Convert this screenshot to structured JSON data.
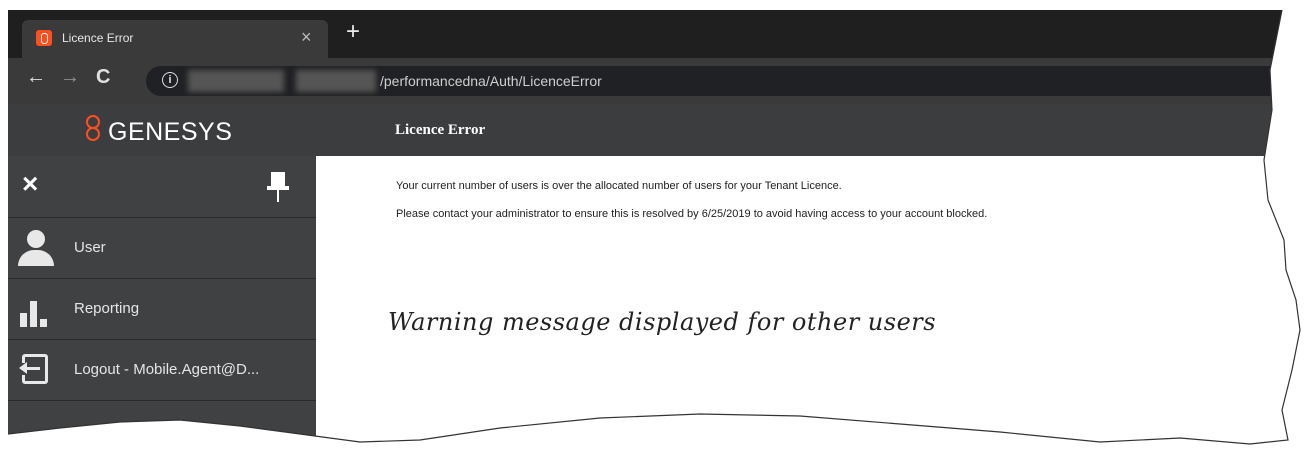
{
  "browser": {
    "tab": {
      "title": "Licence Error",
      "close": "×",
      "favicon": "genesys-favicon-icon"
    },
    "new_tab": "+",
    "nav": {
      "back": "←",
      "forward": "→",
      "reload": "C",
      "info": "i"
    },
    "url": "/performancedna/Auth/LicenceError"
  },
  "app": {
    "logo_text": "GENESYS",
    "page_title": "Licence Error"
  },
  "sidebar": {
    "close_icon": "×",
    "items": [
      {
        "label": "User",
        "icon": "user-icon"
      },
      {
        "label": "Reporting",
        "icon": "bar-chart-icon"
      },
      {
        "label": "Logout - Mobile.Agent@D...",
        "icon": "logout-icon"
      }
    ]
  },
  "content": {
    "message_1": "Your current number of users is over the allocated number of users for your Tenant Licence.",
    "message_2": "Please contact your administrator to ensure this is resolved by 6/25/2019 to avoid having access to your account blocked.",
    "annotation": "Warning message displayed for other users"
  },
  "colors": {
    "brand_accent": "#ff4f1f",
    "sidebar_bg": "#3f4143",
    "header_bg": "#3b3d3f",
    "tabbar_bg": "#1f1f1f"
  }
}
